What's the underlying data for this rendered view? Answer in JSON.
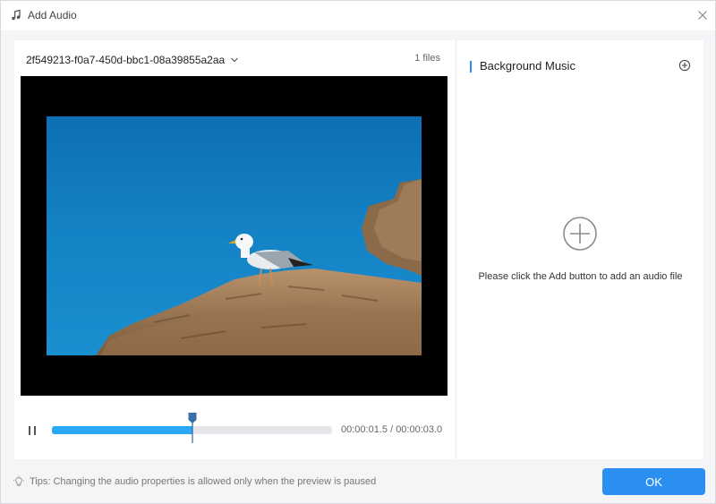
{
  "window": {
    "title": "Add Audio",
    "title_icon": "music-note-icon",
    "close_icon": "close-icon"
  },
  "preview": {
    "file_name": "2f549213-f0a7-450d-bbc1-08a39855a2aa",
    "file_count": "1 files",
    "playback": {
      "current_time": "00:00:01.5",
      "separator": "/",
      "total_time": "00:00:03.0",
      "progress": 0.5
    },
    "play_pause_icon": "pause-icon"
  },
  "background_music": {
    "title": "Background Music",
    "add_icon": "plus-circle-icon",
    "hint": "Please click the Add button to add an audio file"
  },
  "footer": {
    "tip_icon": "lightbulb-icon",
    "tip": "Tips: Changing the audio properties is allowed only when the preview is paused",
    "ok_label": "OK"
  },
  "colors": {
    "accent": "#2a8ff0",
    "progress": "#2aa7f5",
    "panel_bg": "#ffffff",
    "dialog_bg": "#f5f5f7"
  }
}
